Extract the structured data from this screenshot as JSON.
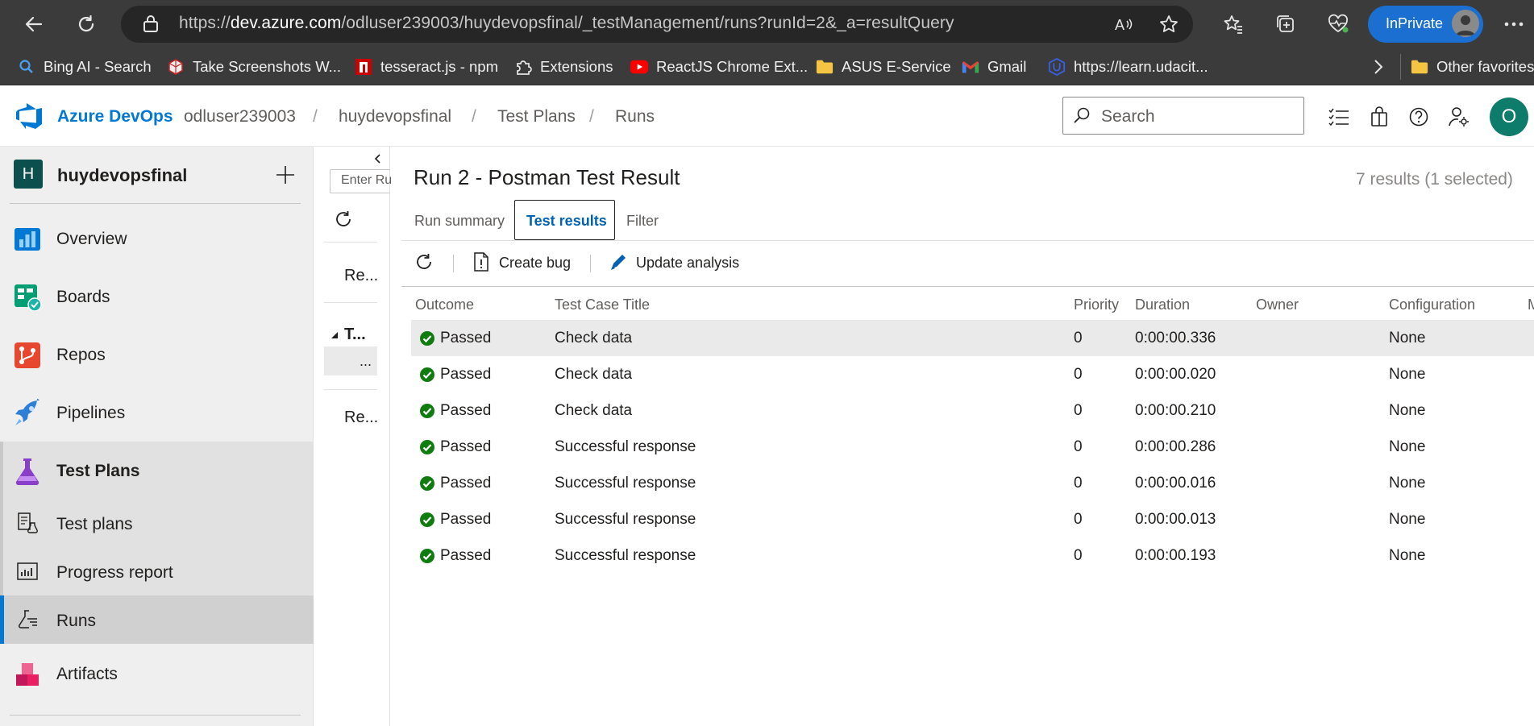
{
  "browser": {
    "url_prefix": "https://",
    "url_host": "dev.azure.com",
    "url_path": "/odluser239003/huydevopsfinal/_testManagement/runs?runId=2&_a=resultQuery",
    "inprivate_label": "InPrivate",
    "accent_color": "#1a6fd0"
  },
  "bookmarks": [
    {
      "label": "Bing AI - Search",
      "icon": "search-icon"
    },
    {
      "label": "Take Screenshots W...",
      "icon": "screenshot-ext-icon"
    },
    {
      "label": "tesseract.js - npm",
      "icon": "npm-icon"
    },
    {
      "label": "Extensions",
      "icon": "puzzle-icon"
    },
    {
      "label": "ReactJS Chrome Ext...",
      "icon": "youtube-icon"
    },
    {
      "label": "ASUS E-Service",
      "icon": "folder-icon"
    },
    {
      "label": "Gmail",
      "icon": "gmail-icon"
    },
    {
      "label": "https://learn.udacit...",
      "icon": "udacity-icon"
    },
    {
      "label": "Other favorites",
      "icon": "folder-icon"
    }
  ],
  "header": {
    "brand": "Azure DevOps",
    "breadcrumb": [
      "odluser239003",
      "huydevopsfinal",
      "Test Plans",
      "Runs"
    ],
    "search_placeholder": "Search",
    "user_initial": "O"
  },
  "sidebar": {
    "project_initial": "H",
    "project_name": "huydevopsfinal",
    "items": [
      {
        "label": "Overview",
        "icon": "overview-icon"
      },
      {
        "label": "Boards",
        "icon": "boards-icon"
      },
      {
        "label": "Repos",
        "icon": "repos-icon"
      },
      {
        "label": "Pipelines",
        "icon": "pipelines-icon"
      },
      {
        "label": "Test Plans",
        "icon": "test-plans-icon"
      },
      {
        "label": "Test plans",
        "icon": "test-plans-sub-icon"
      },
      {
        "label": "Progress report",
        "icon": "progress-report-icon"
      },
      {
        "label": "Runs",
        "icon": "runs-icon"
      },
      {
        "label": "Artifacts",
        "icon": "artifacts-icon"
      }
    ]
  },
  "mid": {
    "input_placeholder": "Enter Ru",
    "item1": "Re...",
    "group": "T...",
    "ellipsis": "...",
    "item2": "Re..."
  },
  "main": {
    "title": "Run 2 - Postman Test Result",
    "results_count": "7 results (1 selected)",
    "tabs": [
      "Run summary",
      "Test results",
      "Filter"
    ],
    "active_tab": "Test results",
    "toolbar": {
      "create_bug": "Create bug",
      "update_analysis": "Update analysis"
    },
    "columns": [
      "Outcome",
      "Test Case Title",
      "Priority",
      "Duration",
      "Owner",
      "Configuration",
      "M"
    ],
    "rows": [
      {
        "outcome": "Passed",
        "title": "Check data",
        "priority": "0",
        "duration": "0:00:00.336",
        "owner": "",
        "configuration": "None"
      },
      {
        "outcome": "Passed",
        "title": "Check data",
        "priority": "0",
        "duration": "0:00:00.020",
        "owner": "",
        "configuration": "None"
      },
      {
        "outcome": "Passed",
        "title": "Check data",
        "priority": "0",
        "duration": "0:00:00.210",
        "owner": "",
        "configuration": "None"
      },
      {
        "outcome": "Passed",
        "title": "Successful response",
        "priority": "0",
        "duration": "0:00:00.286",
        "owner": "",
        "configuration": "None"
      },
      {
        "outcome": "Passed",
        "title": "Successful response",
        "priority": "0",
        "duration": "0:00:00.016",
        "owner": "",
        "configuration": "None"
      },
      {
        "outcome": "Passed",
        "title": "Successful response",
        "priority": "0",
        "duration": "0:00:00.013",
        "owner": "",
        "configuration": "None"
      },
      {
        "outcome": "Passed",
        "title": "Successful response",
        "priority": "0",
        "duration": "0:00:00.193",
        "owner": "",
        "configuration": "None"
      }
    ],
    "passed_color": "#107c10"
  }
}
